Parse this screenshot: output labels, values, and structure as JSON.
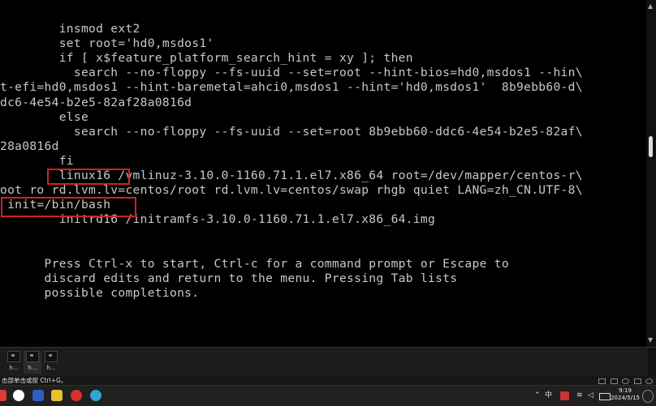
{
  "terminal": {
    "lines": [
      "        insmod ext2",
      "        set root='hd0,msdos1'",
      "        if [ x$feature_platform_search_hint = xy ]; then",
      "          search --no-floppy --fs-uuid --set=root --hint-bios=hd0,msdos1 --hin\\",
      "t-efi=hd0,msdos1 --hint-baremetal=ahci0,msdos1 --hint='hd0,msdos1'  8b9ebb60-d\\",
      "dc6-4e54-b2e5-82af28a0816d",
      "        else",
      "          search --no-floppy --fs-uuid --set=root 8b9ebb60-ddc6-4e54-b2e5-82af\\",
      "28a0816d",
      "        fi",
      "        linux16 /vmlinuz-3.10.0-1160.71.1.el7.x86_64 root=/dev/mapper/centos-r\\",
      "oot ro rd.lvm.lv=centos/root rd.lvm.lv=centos/swap rhgb quiet LANG=zh_CN.UTF-8\\",
      " init=/bin/bash",
      "        initrd16 /initramfs-3.10.0-1160.71.1.el7.x86_64.img",
      "",
      "",
      "      Press Ctrl-x to start, Ctrl-c for a command prompt or Escape to",
      "      discard edits and return to the menu. Pressing Tab lists",
      "      possible completions."
    ],
    "highlight_color": "#d22222"
  },
  "thumbnails": [
    {
      "label": "h..."
    },
    {
      "label": "h..."
    },
    {
      "label": "h..."
    }
  ],
  "status_bar": {
    "text": "击部单击或按 Ctrl+G。"
  },
  "taskbar": {
    "apps": [
      {
        "icon": "red-app-icon",
        "color": "#e0383b"
      },
      {
        "icon": "wechat-icon",
        "color": "#ffffff"
      },
      {
        "icon": "word-icon",
        "color": "#2f5fc2"
      },
      {
        "icon": "screenshot-icon",
        "color": "#e6c32a"
      },
      {
        "icon": "red-circle-app-icon",
        "color": "#d8322c"
      },
      {
        "icon": "edge-icon",
        "color": "#2ea6d6"
      }
    ],
    "tray": {
      "ime": "中",
      "clock_time": "9:19",
      "clock_date": "2024/5/15"
    }
  }
}
